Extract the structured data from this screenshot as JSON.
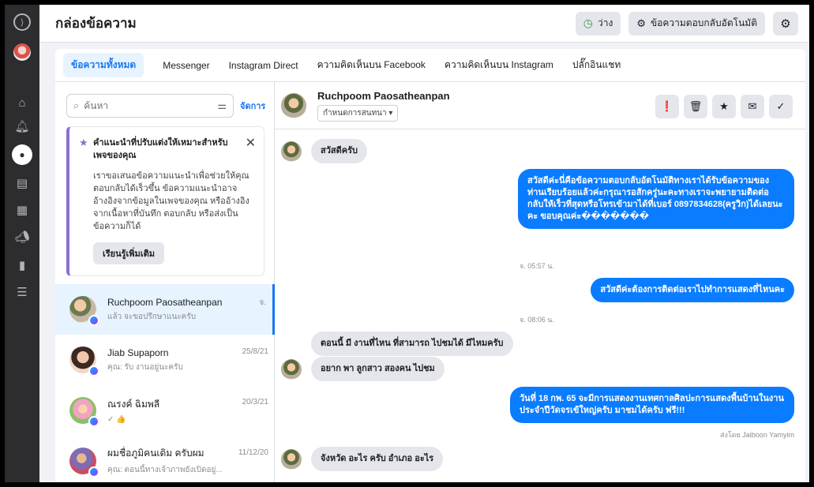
{
  "header": {
    "title": "กล่องข้อความ",
    "status_label": "ว่าง",
    "auto_reply_label": "ข้อความตอบกลับอัตโนมัติ"
  },
  "tabs": [
    {
      "label": "ข้อความทั้งหมด",
      "active": true
    },
    {
      "label": "Messenger"
    },
    {
      "label": "Instagram Direct"
    },
    {
      "label": "ความคิดเห็นบน Facebook"
    },
    {
      "label": "ความคิดเห็นบน Instagram"
    },
    {
      "label": "ปลั๊กอินแชท"
    }
  ],
  "search": {
    "placeholder": "ค้นหา",
    "manage_label": "จัดการ"
  },
  "tip": {
    "title": "คำแนะนำที่ปรับแต่งให้เหมาะสำหรับเพจของคุณ",
    "body": "เราขอเสนอข้อความแนะนำเพื่อช่วยให้คุณตอบกลับได้เร็วขึ้น ข้อความแนะนำอาจอ้างอิงจากข้อมูลในเพจของคุณ หรืออ้างอิงจากเนื้อหาที่บันทึก ตอบกลับ หรือส่งเป็นข้อความก็ได้",
    "button": "เรียนรู้เพิ่มเติม"
  },
  "conversations": [
    {
      "name": "Ruchpoom Paosatheanpan",
      "snippet": "แล้ว จะขอปรึกษาแนะครับ",
      "time": "จ.",
      "active": true
    },
    {
      "name": "Jiab Supaporn",
      "snippet": "คุณ: รับ งานอยู่นะครับ",
      "time": "25/8/21"
    },
    {
      "name": "ณรงค์ ฉิมพลี",
      "snippet": "✓ 👍",
      "time": "20/3/21"
    },
    {
      "name": "ผมชื่อภูมิคนเดิม ครับผม",
      "snippet": "คุณ: ตอนนี้ทางเจ้าภาพยังเปิดอยู่...",
      "time": "11/12/20"
    }
  ],
  "chat": {
    "contact_name": "Ruchpoom Paosatheanpan",
    "assign_label": "กำหนดการสนทนา ▾",
    "messages": [
      {
        "dir": "in",
        "text": "สวัสดีครับ"
      },
      {
        "dir": "out",
        "text": "สวัสดีค่ะนี่คือข้อความตอบกลับอัตโนมัติทางเราได้รับข้อความของท่านเรียบร้อยแล้วค่ะกรุณารอสักครู่นะคะทางเราจะพยายามติดต่อกลับให้เร็วที่สุดหรือโทรเข้ามาได้ที่เบอร์ 0897834628(ครูวิก)ได้เลยนะคะ ขอบคุณค่ะ�������"
      },
      {
        "dir": "out",
        "text": "สวัสดีค่ะต้องการติดต่อเราไปทำการแสดงที่ไหนคะ"
      },
      {
        "dir": "in",
        "text": "ตอนนี้ มี งานที่ไหน ที่สามารถ ไปชมได้ มีไหมครับ"
      },
      {
        "dir": "in",
        "text": "อยาก พา ลูกสาว สองคน ไปชม"
      },
      {
        "dir": "out",
        "text": "วันที่ 18 กพ. 65 จะมีการแสดงงานเทศกาลศิลปะการแสดงพื้นบ้านในงานประจำปีวัดจรเข้ใหญ่ครับ มาชมได้ครับ ฟรี!!!"
      },
      {
        "dir": "in",
        "text": "จังหวัด อะไร ครับ อำเภอ อะไร"
      }
    ],
    "timestamps": [
      "จ. 05:57 น.",
      "จ. 08:06 น."
    ],
    "sent_by": "ส่งโดย Jaiboon Yamyim"
  }
}
